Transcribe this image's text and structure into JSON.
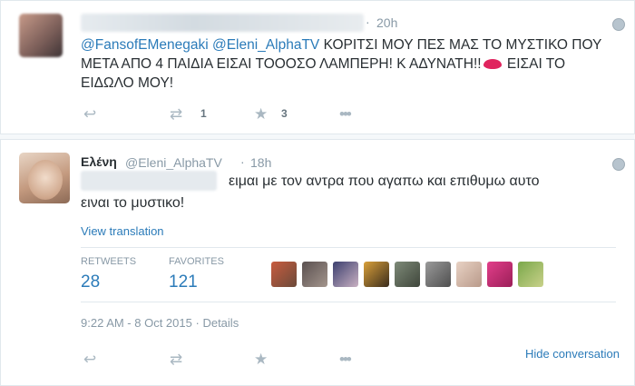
{
  "tweet1": {
    "time": "20h",
    "mentions": [
      "@FansofEMenegaki",
      "@Eleni_AlphaTV"
    ],
    "text": "ΚΟΡΙΤΣΙ ΜΟΥ ΠΕΣ ΜΑΣ ΤΟ ΜΥΣΤΙΚΟ ΠΟΥ ΜΕΤΑ ΑΠΟ 4 ΠΑΙΔΙΑ ΕΙΣΑΙ ΤΟΟΟΣΟ ΛΑΜΠΕΡΗ! Κ ΑΔΥΝΑΤΗ!!",
    "text_end": "ΕΙΣΑΙ ΤΟ ΕΙΔΩΛΟ ΜΟΥ!",
    "retweet_count": "1",
    "favorite_count": "3"
  },
  "tweet2": {
    "name": "Ελένη",
    "handle": "@Eleni_AlphaTV",
    "separator": "·",
    "time": "18h",
    "text_line1": "ειμαι με τον αντρα που αγαπω και επιθυμω αυτο",
    "text_line2": "ειναι το μυστικο!",
    "view_translation": "View translation",
    "retweets_label": "RETWEETS",
    "retweets_value": "28",
    "favorites_label": "FAVORITES",
    "favorites_value": "121",
    "timestamp": "9:22 AM - 8 Oct 2015",
    "details_sep": "·",
    "details": "Details",
    "hide_conversation": "Hide conversation"
  },
  "icons": {
    "reply": "reply-icon",
    "retweet": "retweet-icon",
    "favorite": "star-icon",
    "more": "more-icon",
    "globe": "globe-icon"
  },
  "colors": {
    "link": "#2b7bb9",
    "text": "#292f33",
    "muted": "#8899a6",
    "icon": "#aab8c2"
  }
}
